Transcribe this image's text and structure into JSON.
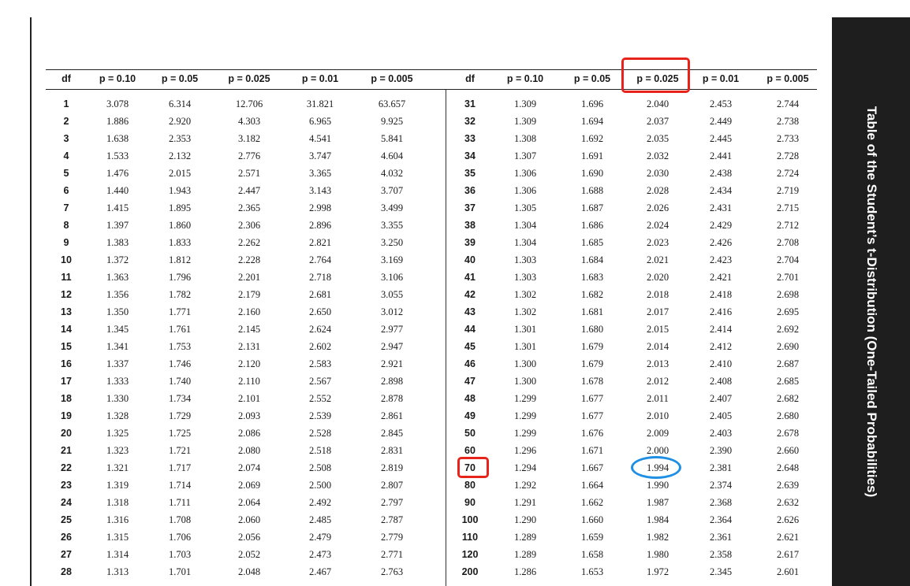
{
  "title": "Table of the Student’s t-Distribution (One-Tailed Probabilities)",
  "headers": [
    "df",
    "p = 0.10",
    "p = 0.05",
    "p = 0.025",
    "p = 0.01",
    "p = 0.005",
    "df",
    "p = 0.10",
    "p = 0.05",
    "p = 0.025",
    "p = 0.01",
    "p = 0.005"
  ],
  "rows": [
    [
      "1",
      "3.078",
      "6.314",
      "12.706",
      "31.821",
      "63.657",
      "31",
      "1.309",
      "1.696",
      "2.040",
      "2.453",
      "2.744"
    ],
    [
      "2",
      "1.886",
      "2.920",
      "4.303",
      "6.965",
      "9.925",
      "32",
      "1.309",
      "1.694",
      "2.037",
      "2.449",
      "2.738"
    ],
    [
      "3",
      "1.638",
      "2.353",
      "3.182",
      "4.541",
      "5.841",
      "33",
      "1.308",
      "1.692",
      "2.035",
      "2.445",
      "2.733"
    ],
    [
      "4",
      "1.533",
      "2.132",
      "2.776",
      "3.747",
      "4.604",
      "34",
      "1.307",
      "1.691",
      "2.032",
      "2.441",
      "2.728"
    ],
    [
      "5",
      "1.476",
      "2.015",
      "2.571",
      "3.365",
      "4.032",
      "35",
      "1.306",
      "1.690",
      "2.030",
      "2.438",
      "2.724"
    ],
    [
      "6",
      "1.440",
      "1.943",
      "2.447",
      "3.143",
      "3.707",
      "36",
      "1.306",
      "1.688",
      "2.028",
      "2.434",
      "2.719"
    ],
    [
      "7",
      "1.415",
      "1.895",
      "2.365",
      "2.998",
      "3.499",
      "37",
      "1.305",
      "1.687",
      "2.026",
      "2.431",
      "2.715"
    ],
    [
      "8",
      "1.397",
      "1.860",
      "2.306",
      "2.896",
      "3.355",
      "38",
      "1.304",
      "1.686",
      "2.024",
      "2.429",
      "2.712"
    ],
    [
      "9",
      "1.383",
      "1.833",
      "2.262",
      "2.821",
      "3.250",
      "39",
      "1.304",
      "1.685",
      "2.023",
      "2.426",
      "2.708"
    ],
    [
      "10",
      "1.372",
      "1.812",
      "2.228",
      "2.764",
      "3.169",
      "40",
      "1.303",
      "1.684",
      "2.021",
      "2.423",
      "2.704"
    ],
    [
      "11",
      "1.363",
      "1.796",
      "2.201",
      "2.718",
      "3.106",
      "41",
      "1.303",
      "1.683",
      "2.020",
      "2.421",
      "2.701"
    ],
    [
      "12",
      "1.356",
      "1.782",
      "2.179",
      "2.681",
      "3.055",
      "42",
      "1.302",
      "1.682",
      "2.018",
      "2.418",
      "2.698"
    ],
    [
      "13",
      "1.350",
      "1.771",
      "2.160",
      "2.650",
      "3.012",
      "43",
      "1.302",
      "1.681",
      "2.017",
      "2.416",
      "2.695"
    ],
    [
      "14",
      "1.345",
      "1.761",
      "2.145",
      "2.624",
      "2.977",
      "44",
      "1.301",
      "1.680",
      "2.015",
      "2.414",
      "2.692"
    ],
    [
      "15",
      "1.341",
      "1.753",
      "2.131",
      "2.602",
      "2.947",
      "45",
      "1.301",
      "1.679",
      "2.014",
      "2.412",
      "2.690"
    ],
    [
      "16",
      "1.337",
      "1.746",
      "2.120",
      "2.583",
      "2.921",
      "46",
      "1.300",
      "1.679",
      "2.013",
      "2.410",
      "2.687"
    ],
    [
      "17",
      "1.333",
      "1.740",
      "2.110",
      "2.567",
      "2.898",
      "47",
      "1.300",
      "1.678",
      "2.012",
      "2.408",
      "2.685"
    ],
    [
      "18",
      "1.330",
      "1.734",
      "2.101",
      "2.552",
      "2.878",
      "48",
      "1.299",
      "1.677",
      "2.011",
      "2.407",
      "2.682"
    ],
    [
      "19",
      "1.328",
      "1.729",
      "2.093",
      "2.539",
      "2.861",
      "49",
      "1.299",
      "1.677",
      "2.010",
      "2.405",
      "2.680"
    ],
    [
      "20",
      "1.325",
      "1.725",
      "2.086",
      "2.528",
      "2.845",
      "50",
      "1.299",
      "1.676",
      "2.009",
      "2.403",
      "2.678"
    ],
    [
      "21",
      "1.323",
      "1.721",
      "2.080",
      "2.518",
      "2.831",
      "60",
      "1.296",
      "1.671",
      "2.000",
      "2.390",
      "2.660"
    ],
    [
      "22",
      "1.321",
      "1.717",
      "2.074",
      "2.508",
      "2.819",
      "70",
      "1.294",
      "1.667",
      "1.994",
      "2.381",
      "2.648"
    ],
    [
      "23",
      "1.319",
      "1.714",
      "2.069",
      "2.500",
      "2.807",
      "80",
      "1.292",
      "1.664",
      "1.990",
      "2.374",
      "2.639"
    ],
    [
      "24",
      "1.318",
      "1.711",
      "2.064",
      "2.492",
      "2.797",
      "90",
      "1.291",
      "1.662",
      "1.987",
      "2.368",
      "2.632"
    ],
    [
      "25",
      "1.316",
      "1.708",
      "2.060",
      "2.485",
      "2.787",
      "100",
      "1.290",
      "1.660",
      "1.984",
      "2.364",
      "2.626"
    ],
    [
      "26",
      "1.315",
      "1.706",
      "2.056",
      "2.479",
      "2.779",
      "110",
      "1.289",
      "1.659",
      "1.982",
      "2.361",
      "2.621"
    ],
    [
      "27",
      "1.314",
      "1.703",
      "2.052",
      "2.473",
      "2.771",
      "120",
      "1.289",
      "1.658",
      "1.980",
      "2.358",
      "2.617"
    ],
    [
      "28",
      "1.313",
      "1.701",
      "2.048",
      "2.467",
      "2.763",
      "200",
      "1.286",
      "1.653",
      "1.972",
      "2.345",
      "2.601"
    ]
  ],
  "annotations": {
    "red_box_color": "#e8231c",
    "blue_ellipse_color": "#1f8fe6"
  }
}
